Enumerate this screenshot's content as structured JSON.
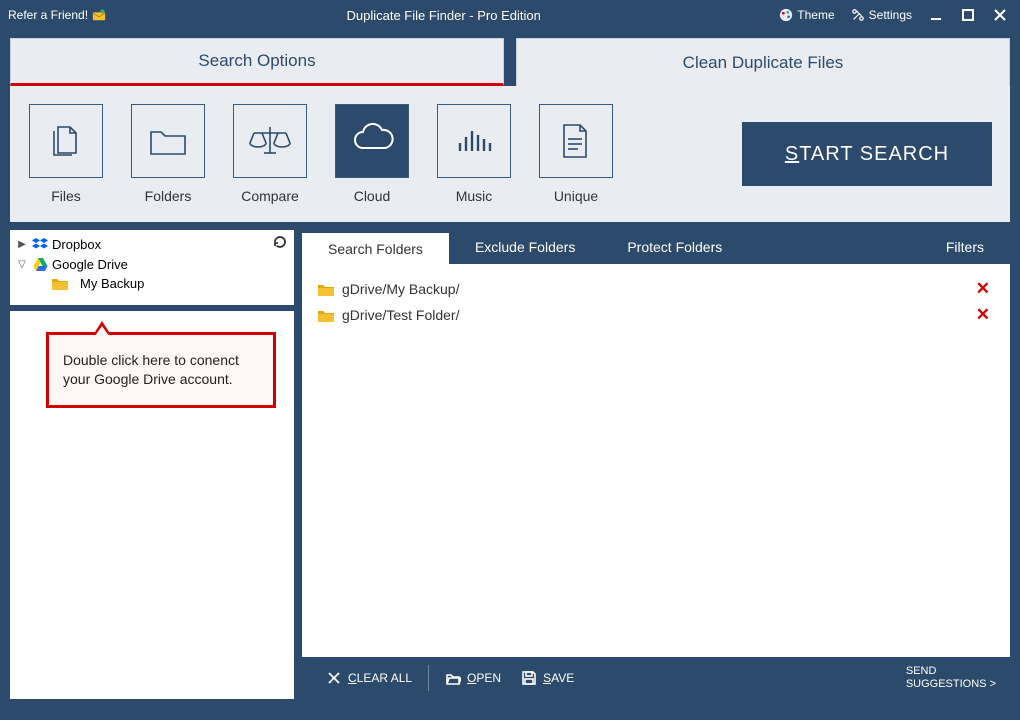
{
  "titlebar": {
    "refer": "Refer a Friend!",
    "title": "Duplicate File Finder - Pro Edition",
    "theme": "Theme",
    "settings": "Settings"
  },
  "main_tabs": {
    "search_options": "Search Options",
    "clean_duplicates": "Clean Duplicate Files"
  },
  "tools": {
    "files": "Files",
    "folders": "Folders",
    "compare": "Compare",
    "cloud": "Cloud",
    "music": "Music",
    "unique": "Unique",
    "start_prefix": "S",
    "start_rest": "TART SEARCH"
  },
  "tree": {
    "dropbox": "Dropbox",
    "gdrive": "Google Drive",
    "gdrive_children": [
      "My Backup"
    ]
  },
  "callout": {
    "text": "Double click here to conenct your Google Drive account."
  },
  "subtabs": {
    "search_folders": "Search Folders",
    "exclude_folders": "Exclude Folders",
    "protect_folders": "Protect Folders",
    "filters": "Filters"
  },
  "search_folders": [
    "gDrive/My Backup/",
    "gDrive/Test Folder/"
  ],
  "footer": {
    "clear_prefix": "C",
    "clear_rest": "LEAR ALL",
    "open_prefix": "O",
    "open_rest": "PEN",
    "save_prefix": "S",
    "save_rest": "AVE",
    "send": "SEND",
    "suggestions": "SUGGESTIONS >"
  },
  "colors": {
    "primary": "#2c4a6b",
    "panel": "#e9edf2",
    "accent_red": "#d40000"
  }
}
